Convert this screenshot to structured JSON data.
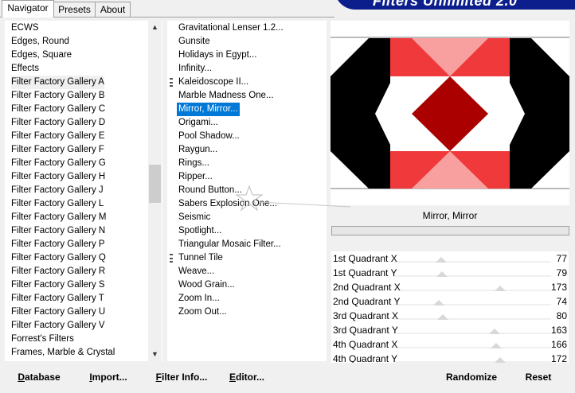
{
  "tabs": [
    {
      "label": "Navigator",
      "active": true
    },
    {
      "label": "Presets",
      "active": false
    },
    {
      "label": "About",
      "active": false
    }
  ],
  "banner": {
    "title": "Filters Unlimited 2.0",
    "color": "#0b1e8c"
  },
  "categories": {
    "selected_index": 4,
    "items": [
      "ECWS",
      "Edges, Round",
      "Edges, Square",
      "Effects",
      "Filter Factory Gallery A",
      "Filter Factory Gallery B",
      "Filter Factory Gallery C",
      "Filter Factory Gallery D",
      "Filter Factory Gallery E",
      "Filter Factory Gallery F",
      "Filter Factory Gallery G",
      "Filter Factory Gallery H",
      "Filter Factory Gallery J",
      "Filter Factory Gallery L",
      "Filter Factory Gallery M",
      "Filter Factory Gallery N",
      "Filter Factory Gallery P",
      "Filter Factory Gallery Q",
      "Filter Factory Gallery R",
      "Filter Factory Gallery S",
      "Filter Factory Gallery T",
      "Filter Factory Gallery U",
      "Filter Factory Gallery V",
      "Forrest's Filters",
      "Frames, Marble & Crystal"
    ]
  },
  "filters": {
    "selected_index": 6,
    "items": [
      {
        "label": "Gravitational Lenser 1.2...",
        "marked": false
      },
      {
        "label": "Gunsite",
        "marked": false
      },
      {
        "label": "Holidays in Egypt...",
        "marked": false
      },
      {
        "label": "Infinity...",
        "marked": false
      },
      {
        "label": "Kaleidoscope II...",
        "marked": true
      },
      {
        "label": "Marble Madness One...",
        "marked": false
      },
      {
        "label": "Mirror, Mirror...",
        "marked": false
      },
      {
        "label": "Origami...",
        "marked": false
      },
      {
        "label": "Pool Shadow...",
        "marked": false
      },
      {
        "label": "Raygun...",
        "marked": false
      },
      {
        "label": "Rings...",
        "marked": false
      },
      {
        "label": "Ripper...",
        "marked": false
      },
      {
        "label": "Round Button...",
        "marked": false
      },
      {
        "label": "Sabers Explosion One...",
        "marked": false
      },
      {
        "label": "Seismic",
        "marked": false
      },
      {
        "label": "Spotlight...",
        "marked": false
      },
      {
        "label": "Triangular Mosaic Filter...",
        "marked": false
      },
      {
        "label": "Tunnel Tile",
        "marked": true
      },
      {
        "label": "Weave...",
        "marked": false
      },
      {
        "label": "Wood Grain...",
        "marked": false
      },
      {
        "label": "Zoom In...",
        "marked": false
      },
      {
        "label": "Zoom Out...",
        "marked": false
      }
    ]
  },
  "preview": {
    "filter_name": "Mirror, Mirror",
    "colors": {
      "black": "#000000",
      "red": "#f0393a",
      "pink": "#f8a0a0",
      "dark_red": "#aa0000",
      "white": "#ffffff"
    }
  },
  "params": [
    {
      "label": "1st Quadrant X",
      "value": 77
    },
    {
      "label": "1st Quadrant Y",
      "value": 79
    },
    {
      "label": "2nd Quadrant X",
      "value": 173
    },
    {
      "label": "2nd Quadrant Y",
      "value": 74
    },
    {
      "label": "3rd Quadrant X",
      "value": 80
    },
    {
      "label": "3rd Quadrant Y",
      "value": 163
    },
    {
      "label": "4th Quadrant X",
      "value": 166
    },
    {
      "label": "4th Quadrant Y",
      "value": 172
    }
  ],
  "param_max": 255,
  "buttons": {
    "database": {
      "prefix": "D",
      "rest": "atabase"
    },
    "import": {
      "prefix": "I",
      "rest": "mport..."
    },
    "filter_info": {
      "prefix": "F",
      "rest": "ilter Info..."
    },
    "editor": {
      "prefix": "E",
      "rest": "ditor..."
    },
    "randomize": "Randomize",
    "reset": "Reset"
  },
  "accent_color": "#0078d7"
}
